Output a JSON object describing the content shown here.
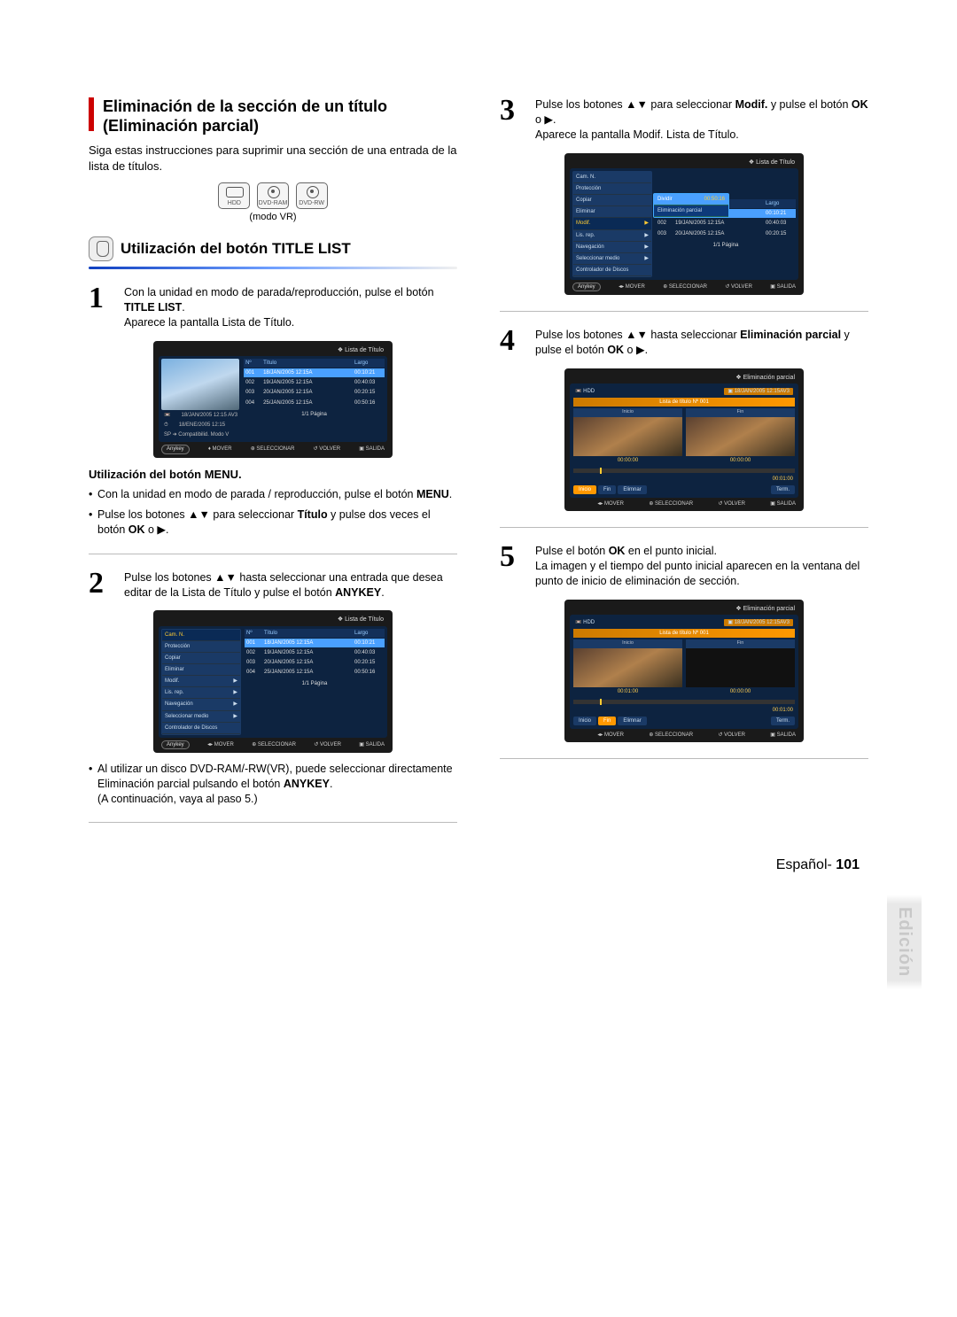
{
  "section": {
    "title": "Eliminación de la sección de un título (Eliminación parcial)",
    "intro": "Siga estas instrucciones para suprimir una sección de una entrada de la lista de títulos.",
    "discs": {
      "hdd": "HDD",
      "ram": "DVD-RAM",
      "rw": "DVD-RW"
    },
    "mode_sub": "(modo VR)",
    "sub1_title": "Utilización del botón TITLE LIST"
  },
  "steps": {
    "s1": {
      "num": "1",
      "text": "Con la unidad en modo de parada/reproducción, pulse el botón ",
      "btn": "TITLE LIST",
      "after": ".",
      "result": "Aparece la pantalla Lista de Título."
    },
    "menu_heading": "Utilización del botón MENU.",
    "menu_b1": "Con la unidad en modo de parada / reproducción, pulse el botón ",
    "menu_b1_btn": "MENU",
    "menu_b1_after": ".",
    "menu_b2_a": "Pulse los botones ▲▼ para seleccionar ",
    "menu_b2_bold": "Título",
    "menu_b2_b": " y pulse dos veces el botón ",
    "menu_b2_btn": "OK",
    "menu_b2_c": " o ▶.",
    "s2": {
      "num": "2",
      "a": "Pulse los botones ▲▼ hasta seleccionar una entrada que desea editar de la Lista de Título y pulse el botón ",
      "btn": "ANYKEY",
      "after": "."
    },
    "s2_note_a": "Al utilizar un disco DVD-RAM/-RW(VR), puede seleccionar directamente Eliminación parcial pulsando el botón ",
    "s2_note_btn": "ANYKEY",
    "s2_note_b": ".",
    "s2_note_c": "(A continuación, vaya al paso 5.)",
    "s3": {
      "num": "3",
      "a": "Pulse los botones ▲▼ para seleccionar ",
      "bold1": "Modif.",
      "b": " y pulse el botón ",
      "bold2": "OK",
      "c": " o ▶.",
      "result": "Aparece la pantalla Modif. Lista de Título."
    },
    "s4": {
      "num": "4",
      "a": "Pulse los botones ▲▼ hasta seleccionar ",
      "bold1": "Eliminación parcial",
      "b": " y pulse el botón ",
      "bold2": "OK",
      "c": " o ▶."
    },
    "s5": {
      "num": "5",
      "a": "Pulse el botón ",
      "bold1": "OK",
      "b": " en el punto inicial.",
      "result": "La imagen y el tiempo del punto inicial aparecen en la ventana del punto de inicio de eliminación de sección."
    }
  },
  "shot_common": {
    "title_list": "Lista de Título",
    "partial": "Eliminación parcial",
    "cols": {
      "no": "Nº",
      "title": "Título",
      "len": "Largo"
    },
    "rows": [
      {
        "n": "001",
        "t": "18/JAN/2005 12:15A",
        "l": "00:10:21"
      },
      {
        "n": "002",
        "t": "19/JAN/2005 12:15A",
        "l": "00:40:03"
      },
      {
        "n": "003",
        "t": "20/JAN/2005 12:15A",
        "l": "00:20:15"
      },
      {
        "n": "004",
        "t": "25/JAN/2005 12:15A",
        "l": "00:50:16"
      }
    ],
    "meta1": "18/JAN/2005 12:15 AV3",
    "meta2": "18/ENE/2005 12:15",
    "meta3": "SP ➜ Compatibilid. Modo V",
    "pager": "1/1 Página",
    "anykey": "Anykey",
    "foot_move": "MOVER",
    "foot_move_lr": "MOVER",
    "foot_sel": "SELECCIONAR",
    "foot_ret": "VOLVER",
    "foot_exit": "SALIDA",
    "side_items": [
      "Cam. N.",
      "Protección",
      "Copiar",
      "Eliminar",
      "Modif.",
      "Lis. rep.",
      "Navegación",
      "Seleccionar medio",
      "Controlador de Discos"
    ],
    "popup_divide": "Dividir",
    "popup_divide_len": "00:50:16",
    "popup_partial": "Eliminación parcial"
  },
  "pshot": {
    "hdd": "HDD",
    "clip": "18/JAN/2005 12:15AV3",
    "list_label": "Lista de título Nº  001",
    "start": "Inicio",
    "end": "Fin",
    "t_zeroa": "00:00:00",
    "t_zerob": "00:00:00",
    "t_start_set": "00:01:00",
    "dur": "00:01:00",
    "btn_start": "Inicio",
    "btn_end": "Fin",
    "btn_del": "Elimnar",
    "btn_term": "Term."
  },
  "side_tab": "Edición",
  "footer": {
    "lang": "Español",
    "sep": "- ",
    "page": "101"
  }
}
